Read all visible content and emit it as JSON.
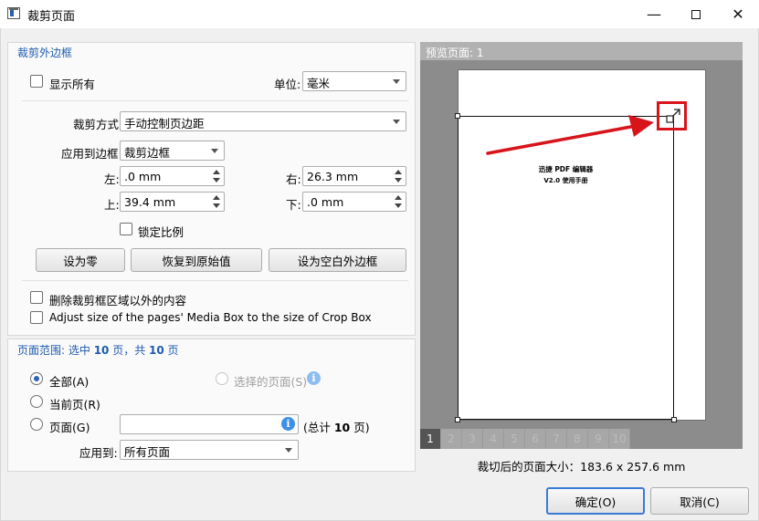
{
  "window": {
    "title": "裁剪页面"
  },
  "crop_box": {
    "title": "裁剪外边框",
    "show_all_label": "显示所有",
    "unit_label": "单位:",
    "unit_value": "毫米",
    "crop_mode_label": "裁剪方式",
    "crop_mode_value": "手动控制页边距",
    "apply_to_label": "应用到边框",
    "apply_to_value": "裁剪边框",
    "left_label": "左:",
    "left_value": ".0 mm",
    "right_label": "右:",
    "right_value": "26.3 mm",
    "top_label": "上:",
    "top_value": "39.4 mm",
    "bottom_label": "下:",
    "bottom_value": ".0 mm",
    "lock_ratio_label": "锁定比例",
    "set_zero_label": "设为零",
    "restore_label": "恢复到原始值",
    "set_white_margin_label": "设为空白外边框",
    "delete_outside_label": "删除裁剪框区域以外的内容",
    "adjust_media_label": "Adjust size of the pages' Media Box to the size of Crop Box"
  },
  "page_range": {
    "title_prefix": "页面范围: 选中 ",
    "selected_count": "10",
    "title_mid": " 页，共 ",
    "total_count": "10",
    "title_suffix": " 页",
    "all_label": "全部(A)",
    "selected_pages_label": "选择的页面(S)",
    "current_page_label": "当前页(R)",
    "pages_label": "页面(G)",
    "pages_value": "",
    "total_prefix": "(总计 ",
    "total_value": "10",
    "total_suffix": " 页)",
    "apply_to_label": "应用到:",
    "apply_to_value": "所有页面"
  },
  "preview": {
    "header": "预览页面: 1",
    "doc_title": "迅捷 PDF 编辑器",
    "doc_subtitle": "V2.0 使用手册",
    "page_tabs": [
      "1",
      "2",
      "3",
      "4",
      "5",
      "6",
      "7",
      "8",
      "9",
      "10"
    ],
    "active_tab": 0,
    "crop_size_text": "裁切后的页面大小：183.6 x 257.6 mm"
  },
  "footer": {
    "ok_label": "确定(O)",
    "cancel_label": "取消(C)"
  },
  "colors": {
    "accent": "#1e5bb0",
    "highlight": "#d8141b",
    "info": "#3d8ee6"
  }
}
